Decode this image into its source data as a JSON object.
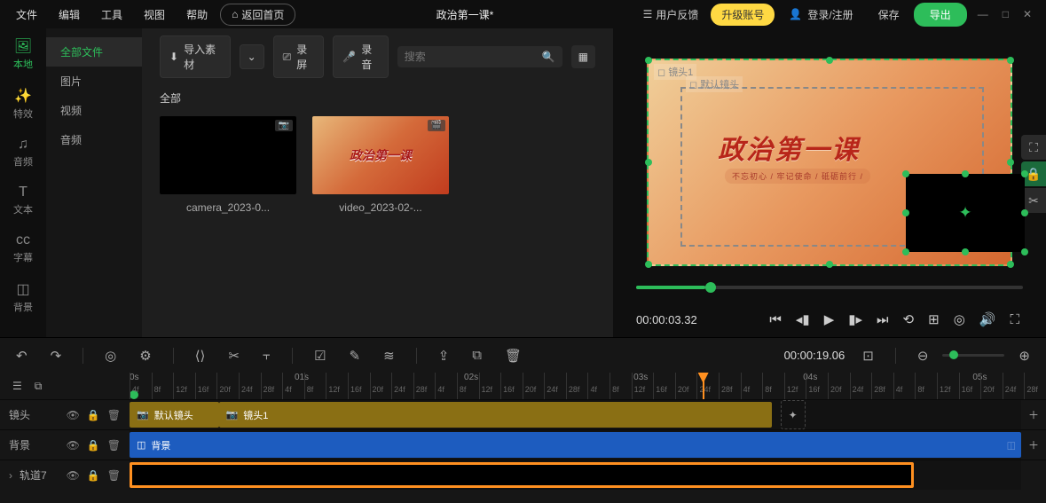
{
  "menu": {
    "file": "文件",
    "edit": "编辑",
    "tool": "工具",
    "view": "视图",
    "help": "帮助",
    "return_home": "返回首页"
  },
  "header": {
    "project_title": "政治第一课*",
    "feedback": "用户反馈",
    "upgrade": "升级账号",
    "login": "登录/注册",
    "save": "保存",
    "export": "导出"
  },
  "left_tabs": {
    "local": "本地",
    "effects": "特效",
    "audio": "音频",
    "text": "文本",
    "subtitle": "字幕",
    "background": "背景"
  },
  "file_panel": {
    "all_files": "全部文件",
    "image": "图片",
    "video": "视频",
    "audio": "音频"
  },
  "media": {
    "import": "导入素材",
    "record_screen": "录屏",
    "record_audio": "录音",
    "search_placeholder": "搜索",
    "category": "全部",
    "items": [
      {
        "name": "camera_2023-0..."
      },
      {
        "name": "video_2023-02-..."
      }
    ]
  },
  "preview": {
    "scene_label": "镜头1",
    "default_label": "默认镜头",
    "title_text": "政治第一课",
    "subtitle_text": "不忘初心 / 牢记使命 / 砥砺前行 /",
    "current_time": "00:00:03.32"
  },
  "toolrow": {
    "timeline_time": "00:00:19.06"
  },
  "ruler": {
    "seconds": [
      "0s",
      "01s",
      "02s",
      "03s",
      "04s",
      "05s"
    ],
    "frames": [
      "4f",
      "8f",
      "12f",
      "16f",
      "20f",
      "24f",
      "28f"
    ]
  },
  "tracks": {
    "scene": {
      "name": "镜头",
      "clip1": "默认镜头",
      "clip2": "镜头1"
    },
    "bg": {
      "name": "背景",
      "clip": "背景"
    },
    "t7": {
      "name": "轨道7"
    }
  }
}
